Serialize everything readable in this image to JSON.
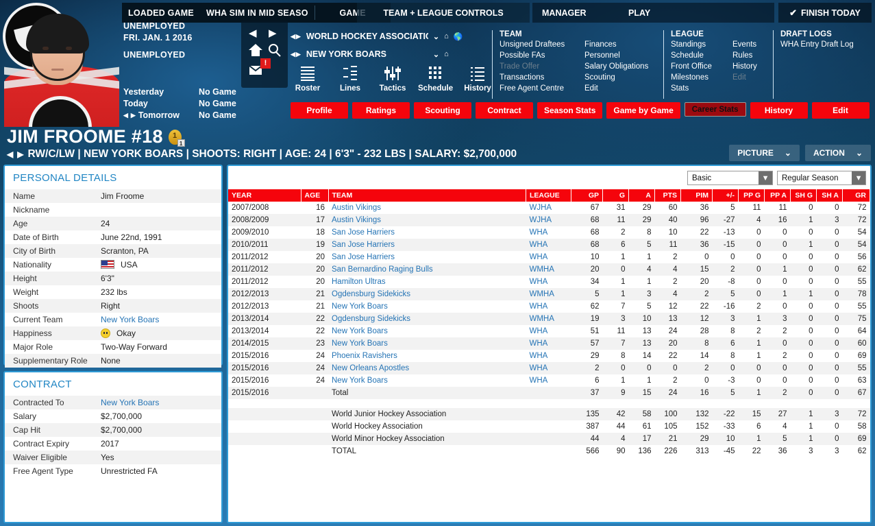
{
  "topbar": {
    "tabs": [
      "LOADED GAME",
      "WHA SIM IN MID SEASO",
      "GAME"
    ],
    "team_league_controls": "TEAM + LEAGUE CONTROLS",
    "manager": "MANAGER",
    "play": "PLAY",
    "finish_today": "FINISH TODAY",
    "check_icon": "check-icon"
  },
  "left": {
    "status1": "UNEMPLOYED",
    "date": "FRI. JAN. 1 2016",
    "status2": "UNEMPLOYED",
    "games": [
      {
        "label": "Yesterday",
        "value": "No Game"
      },
      {
        "label": "Today",
        "value": "No Game"
      },
      {
        "label": "Tomorrow",
        "value": "No Game"
      }
    ]
  },
  "nav": {
    "prev_icon": "arrow-left-icon",
    "next_icon": "arrow-right-icon",
    "home_icon": "home-icon",
    "search_icon": "search-icon",
    "mail_icon": "mail-icon",
    "badge": "!"
  },
  "selector": {
    "league": "WORLD HOCKEY ASSOCIATION",
    "team": "NEW YORK BOARS"
  },
  "iconrow": [
    {
      "label": "Roster",
      "icon": "roster-lines-icon"
    },
    {
      "label": "Lines",
      "icon": "lines-icon"
    },
    {
      "label": "Tactics",
      "icon": "tactics-sliders-icon"
    },
    {
      "label": "Schedule",
      "icon": "schedule-grid-icon"
    },
    {
      "label": "History",
      "icon": "history-list-icon"
    }
  ],
  "menus": {
    "team": {
      "title": "TEAM",
      "col1": [
        {
          "label": "Unsigned Draftees",
          "disabled": false
        },
        {
          "label": "Possible FAs",
          "disabled": false
        },
        {
          "label": "Trade Offer",
          "disabled": true
        },
        {
          "label": "Transactions",
          "disabled": false
        },
        {
          "label": "Free Agent Centre",
          "disabled": false
        }
      ],
      "col2": [
        {
          "label": "Finances",
          "disabled": false
        },
        {
          "label": "Personnel",
          "disabled": false
        },
        {
          "label": "Salary Obligations",
          "disabled": false
        },
        {
          "label": "Scouting",
          "disabled": false
        },
        {
          "label": "Edit",
          "disabled": false
        }
      ]
    },
    "league": {
      "title": "LEAGUE",
      "col1": [
        {
          "label": "Standings",
          "disabled": false
        },
        {
          "label": "Schedule",
          "disabled": false
        },
        {
          "label": "Front Office",
          "disabled": false
        },
        {
          "label": "Milestones",
          "disabled": false
        },
        {
          "label": "Stats",
          "disabled": false
        }
      ],
      "col2": [
        {
          "label": "Events",
          "disabled": false
        },
        {
          "label": "Rules",
          "disabled": false
        },
        {
          "label": "History",
          "disabled": false
        },
        {
          "label": "Edit",
          "disabled": true
        }
      ]
    },
    "draft": {
      "title": "DRAFT LOGS",
      "col1": [
        {
          "label": "WHA Entry Draft Log",
          "disabled": false
        }
      ],
      "col2": []
    }
  },
  "red_tabs": [
    {
      "label": "Profile",
      "selected": false
    },
    {
      "label": "Ratings",
      "selected": false
    },
    {
      "label": "Scouting",
      "selected": false
    },
    {
      "label": "Contract",
      "selected": false
    },
    {
      "label": "Season Stats",
      "selected": false
    },
    {
      "label": "Game by Game",
      "selected": false
    },
    {
      "label": "Career Stats",
      "selected": true
    },
    {
      "label": "History",
      "selected": false
    },
    {
      "label": "Edit",
      "selected": false
    }
  ],
  "player": {
    "name_line": "JIM FROOME #18",
    "medal": "1",
    "medal_sub": "1",
    "subtitle": "RW/C/LW | NEW YORK BOARS | SHOOTS: RIGHT | AGE: 24 | 6'3\" - 232 LBS | SALARY: $2,700,000",
    "picture_button": "PICTURE",
    "action_button": "ACTION"
  },
  "personal": {
    "title": "PERSONAL DETAILS",
    "rows": [
      {
        "k": "Name",
        "v": "Jim Froome",
        "link": false
      },
      {
        "k": "Nickname",
        "v": "",
        "link": false
      },
      {
        "k": "Age",
        "v": "24",
        "link": false
      },
      {
        "k": "Date of Birth",
        "v": "June 22nd, 1991",
        "link": false
      },
      {
        "k": "City of Birth",
        "v": "Scranton, PA",
        "link": false
      },
      {
        "k": "Nationality",
        "v": "USA",
        "link": false,
        "icon": "usa-flag-icon"
      },
      {
        "k": "Height",
        "v": "6'3\"",
        "link": false
      },
      {
        "k": "Weight",
        "v": "232 lbs",
        "link": false
      },
      {
        "k": "Shoots",
        "v": "Right",
        "link": false
      },
      {
        "k": "Current Team",
        "v": "New York Boars",
        "link": true
      },
      {
        "k": "Happiness",
        "v": "Okay",
        "link": false,
        "icon": "neutral-face-icon"
      },
      {
        "k": "Major Role",
        "v": "Two-Way Forward",
        "link": false
      },
      {
        "k": "Supplementary Role",
        "v": "None",
        "link": false
      }
    ]
  },
  "contract": {
    "title": "CONTRACT",
    "rows": [
      {
        "k": "Contracted To",
        "v": "New York Boars",
        "link": true
      },
      {
        "k": "Salary",
        "v": "$2,700,000",
        "link": false
      },
      {
        "k": "Cap Hit",
        "v": "$2,700,000",
        "link": false
      },
      {
        "k": "Contract Expiry",
        "v": "2017",
        "link": false
      },
      {
        "k": "Waiver Eligible",
        "v": "Yes",
        "link": false
      },
      {
        "k": "Free Agent Type",
        "v": "Unrestricted FA",
        "link": false
      }
    ]
  },
  "stats": {
    "filter_basic": "Basic",
    "filter_season": "Regular Season",
    "columns": [
      "YEAR",
      "AGE",
      "TEAM",
      "LEAGUE",
      "GP",
      "G",
      "A",
      "PTS",
      "PIM",
      "+/-",
      "PP G",
      "PP A",
      "SH G",
      "SH A",
      "GR"
    ],
    "rows": [
      {
        "year": "2007/2008",
        "age": "16",
        "team": "Austin Vikings",
        "league": "WJHA",
        "gp": "67",
        "g": "31",
        "a": "29",
        "pts": "60",
        "pim": "36",
        "pm": "5",
        "ppg": "11",
        "ppa": "11",
        "shg": "0",
        "sha": "0",
        "gr": "72",
        "link": true
      },
      {
        "year": "2008/2009",
        "age": "17",
        "team": "Austin Vikings",
        "league": "WJHA",
        "gp": "68",
        "g": "11",
        "a": "29",
        "pts": "40",
        "pim": "96",
        "pm": "-27",
        "ppg": "4",
        "ppa": "16",
        "shg": "1",
        "sha": "3",
        "gr": "72",
        "link": true
      },
      {
        "year": "2009/2010",
        "age": "18",
        "team": "San Jose Harriers",
        "league": "WHA",
        "gp": "68",
        "g": "2",
        "a": "8",
        "pts": "10",
        "pim": "22",
        "pm": "-13",
        "ppg": "0",
        "ppa": "0",
        "shg": "0",
        "sha": "0",
        "gr": "54",
        "link": true
      },
      {
        "year": "2010/2011",
        "age": "19",
        "team": "San Jose Harriers",
        "league": "WHA",
        "gp": "68",
        "g": "6",
        "a": "5",
        "pts": "11",
        "pim": "36",
        "pm": "-15",
        "ppg": "0",
        "ppa": "0",
        "shg": "1",
        "sha": "0",
        "gr": "54",
        "link": true
      },
      {
        "year": "2011/2012",
        "age": "20",
        "team": "San Jose Harriers",
        "league": "WHA",
        "gp": "10",
        "g": "1",
        "a": "1",
        "pts": "2",
        "pim": "0",
        "pm": "0",
        "ppg": "0",
        "ppa": "0",
        "shg": "0",
        "sha": "0",
        "gr": "56",
        "link": true
      },
      {
        "year": "2011/2012",
        "age": "20",
        "team": "San Bernardino Raging Bulls",
        "league": "WMHA",
        "gp": "20",
        "g": "0",
        "a": "4",
        "pts": "4",
        "pim": "15",
        "pm": "2",
        "ppg": "0",
        "ppa": "1",
        "shg": "0",
        "sha": "0",
        "gr": "62",
        "link": true
      },
      {
        "year": "2011/2012",
        "age": "20",
        "team": "Hamilton Ultras",
        "league": "WHA",
        "gp": "34",
        "g": "1",
        "a": "1",
        "pts": "2",
        "pim": "20",
        "pm": "-8",
        "ppg": "0",
        "ppa": "0",
        "shg": "0",
        "sha": "0",
        "gr": "55",
        "link": true
      },
      {
        "year": "2012/2013",
        "age": "21",
        "team": "Ogdensburg Sidekicks",
        "league": "WMHA",
        "gp": "5",
        "g": "1",
        "a": "3",
        "pts": "4",
        "pim": "2",
        "pm": "5",
        "ppg": "0",
        "ppa": "1",
        "shg": "1",
        "sha": "0",
        "gr": "78",
        "link": true
      },
      {
        "year": "2012/2013",
        "age": "21",
        "team": "New York Boars",
        "league": "WHA",
        "gp": "62",
        "g": "7",
        "a": "5",
        "pts": "12",
        "pim": "22",
        "pm": "-16",
        "ppg": "2",
        "ppa": "0",
        "shg": "0",
        "sha": "0",
        "gr": "55",
        "link": true
      },
      {
        "year": "2013/2014",
        "age": "22",
        "team": "Ogdensburg Sidekicks",
        "league": "WMHA",
        "gp": "19",
        "g": "3",
        "a": "10",
        "pts": "13",
        "pim": "12",
        "pm": "3",
        "ppg": "1",
        "ppa": "3",
        "shg": "0",
        "sha": "0",
        "gr": "75",
        "link": true
      },
      {
        "year": "2013/2014",
        "age": "22",
        "team": "New York Boars",
        "league": "WHA",
        "gp": "51",
        "g": "11",
        "a": "13",
        "pts": "24",
        "pim": "28",
        "pm": "8",
        "ppg": "2",
        "ppa": "2",
        "shg": "0",
        "sha": "0",
        "gr": "64",
        "link": true
      },
      {
        "year": "2014/2015",
        "age": "23",
        "team": "New York Boars",
        "league": "WHA",
        "gp": "57",
        "g": "7",
        "a": "13",
        "pts": "20",
        "pim": "8",
        "pm": "6",
        "ppg": "1",
        "ppa": "0",
        "shg": "0",
        "sha": "0",
        "gr": "60",
        "link": true
      },
      {
        "year": "2015/2016",
        "age": "24",
        "team": "Phoenix Ravishers",
        "league": "WHA",
        "gp": "29",
        "g": "8",
        "a": "14",
        "pts": "22",
        "pim": "14",
        "pm": "8",
        "ppg": "1",
        "ppa": "2",
        "shg": "0",
        "sha": "0",
        "gr": "69",
        "link": true
      },
      {
        "year": "2015/2016",
        "age": "24",
        "team": "New Orleans Apostles",
        "league": "WHA",
        "gp": "2",
        "g": "0",
        "a": "0",
        "pts": "0",
        "pim": "2",
        "pm": "0",
        "ppg": "0",
        "ppa": "0",
        "shg": "0",
        "sha": "0",
        "gr": "55",
        "link": true
      },
      {
        "year": "2015/2016",
        "age": "24",
        "team": "New York Boars",
        "league": "WHA",
        "gp": "6",
        "g": "1",
        "a": "1",
        "pts": "2",
        "pim": "0",
        "pm": "-3",
        "ppg": "0",
        "ppa": "0",
        "shg": "0",
        "sha": "0",
        "gr": "63",
        "link": true
      },
      {
        "year": "2015/2016",
        "age": "",
        "team": "Total",
        "league": "",
        "gp": "37",
        "g": "9",
        "a": "15",
        "pts": "24",
        "pim": "16",
        "pm": "5",
        "ppg": "1",
        "ppa": "2",
        "shg": "0",
        "sha": "0",
        "gr": "67",
        "link": false
      }
    ],
    "summary": [
      {
        "year": "",
        "age": "",
        "team": "World Junior Hockey Association",
        "league": "",
        "gp": "135",
        "g": "42",
        "a": "58",
        "pts": "100",
        "pim": "132",
        "pm": "-22",
        "ppg": "15",
        "ppa": "27",
        "shg": "1",
        "sha": "3",
        "gr": "72",
        "link": false
      },
      {
        "year": "",
        "age": "",
        "team": "World Hockey Association",
        "league": "",
        "gp": "387",
        "g": "44",
        "a": "61",
        "pts": "105",
        "pim": "152",
        "pm": "-33",
        "ppg": "6",
        "ppa": "4",
        "shg": "1",
        "sha": "0",
        "gr": "58",
        "link": false
      },
      {
        "year": "",
        "age": "",
        "team": "World Minor Hockey Association",
        "league": "",
        "gp": "44",
        "g": "4",
        "a": "17",
        "pts": "21",
        "pim": "29",
        "pm": "10",
        "ppg": "1",
        "ppa": "5",
        "shg": "1",
        "sha": "0",
        "gr": "69",
        "link": false
      },
      {
        "year": "",
        "age": "",
        "team": "TOTAL",
        "league": "",
        "gp": "566",
        "g": "90",
        "a": "136",
        "pts": "226",
        "pim": "313",
        "pm": "-45",
        "ppg": "22",
        "ppa": "36",
        "shg": "3",
        "sha": "3",
        "gr": "62",
        "link": false
      }
    ]
  },
  "colors": {
    "red": "#f5040c",
    "red_selected": "#9c0a10",
    "panel_border": "#2f9bd6",
    "heading": "#2186c4",
    "link": "#2574b5"
  }
}
